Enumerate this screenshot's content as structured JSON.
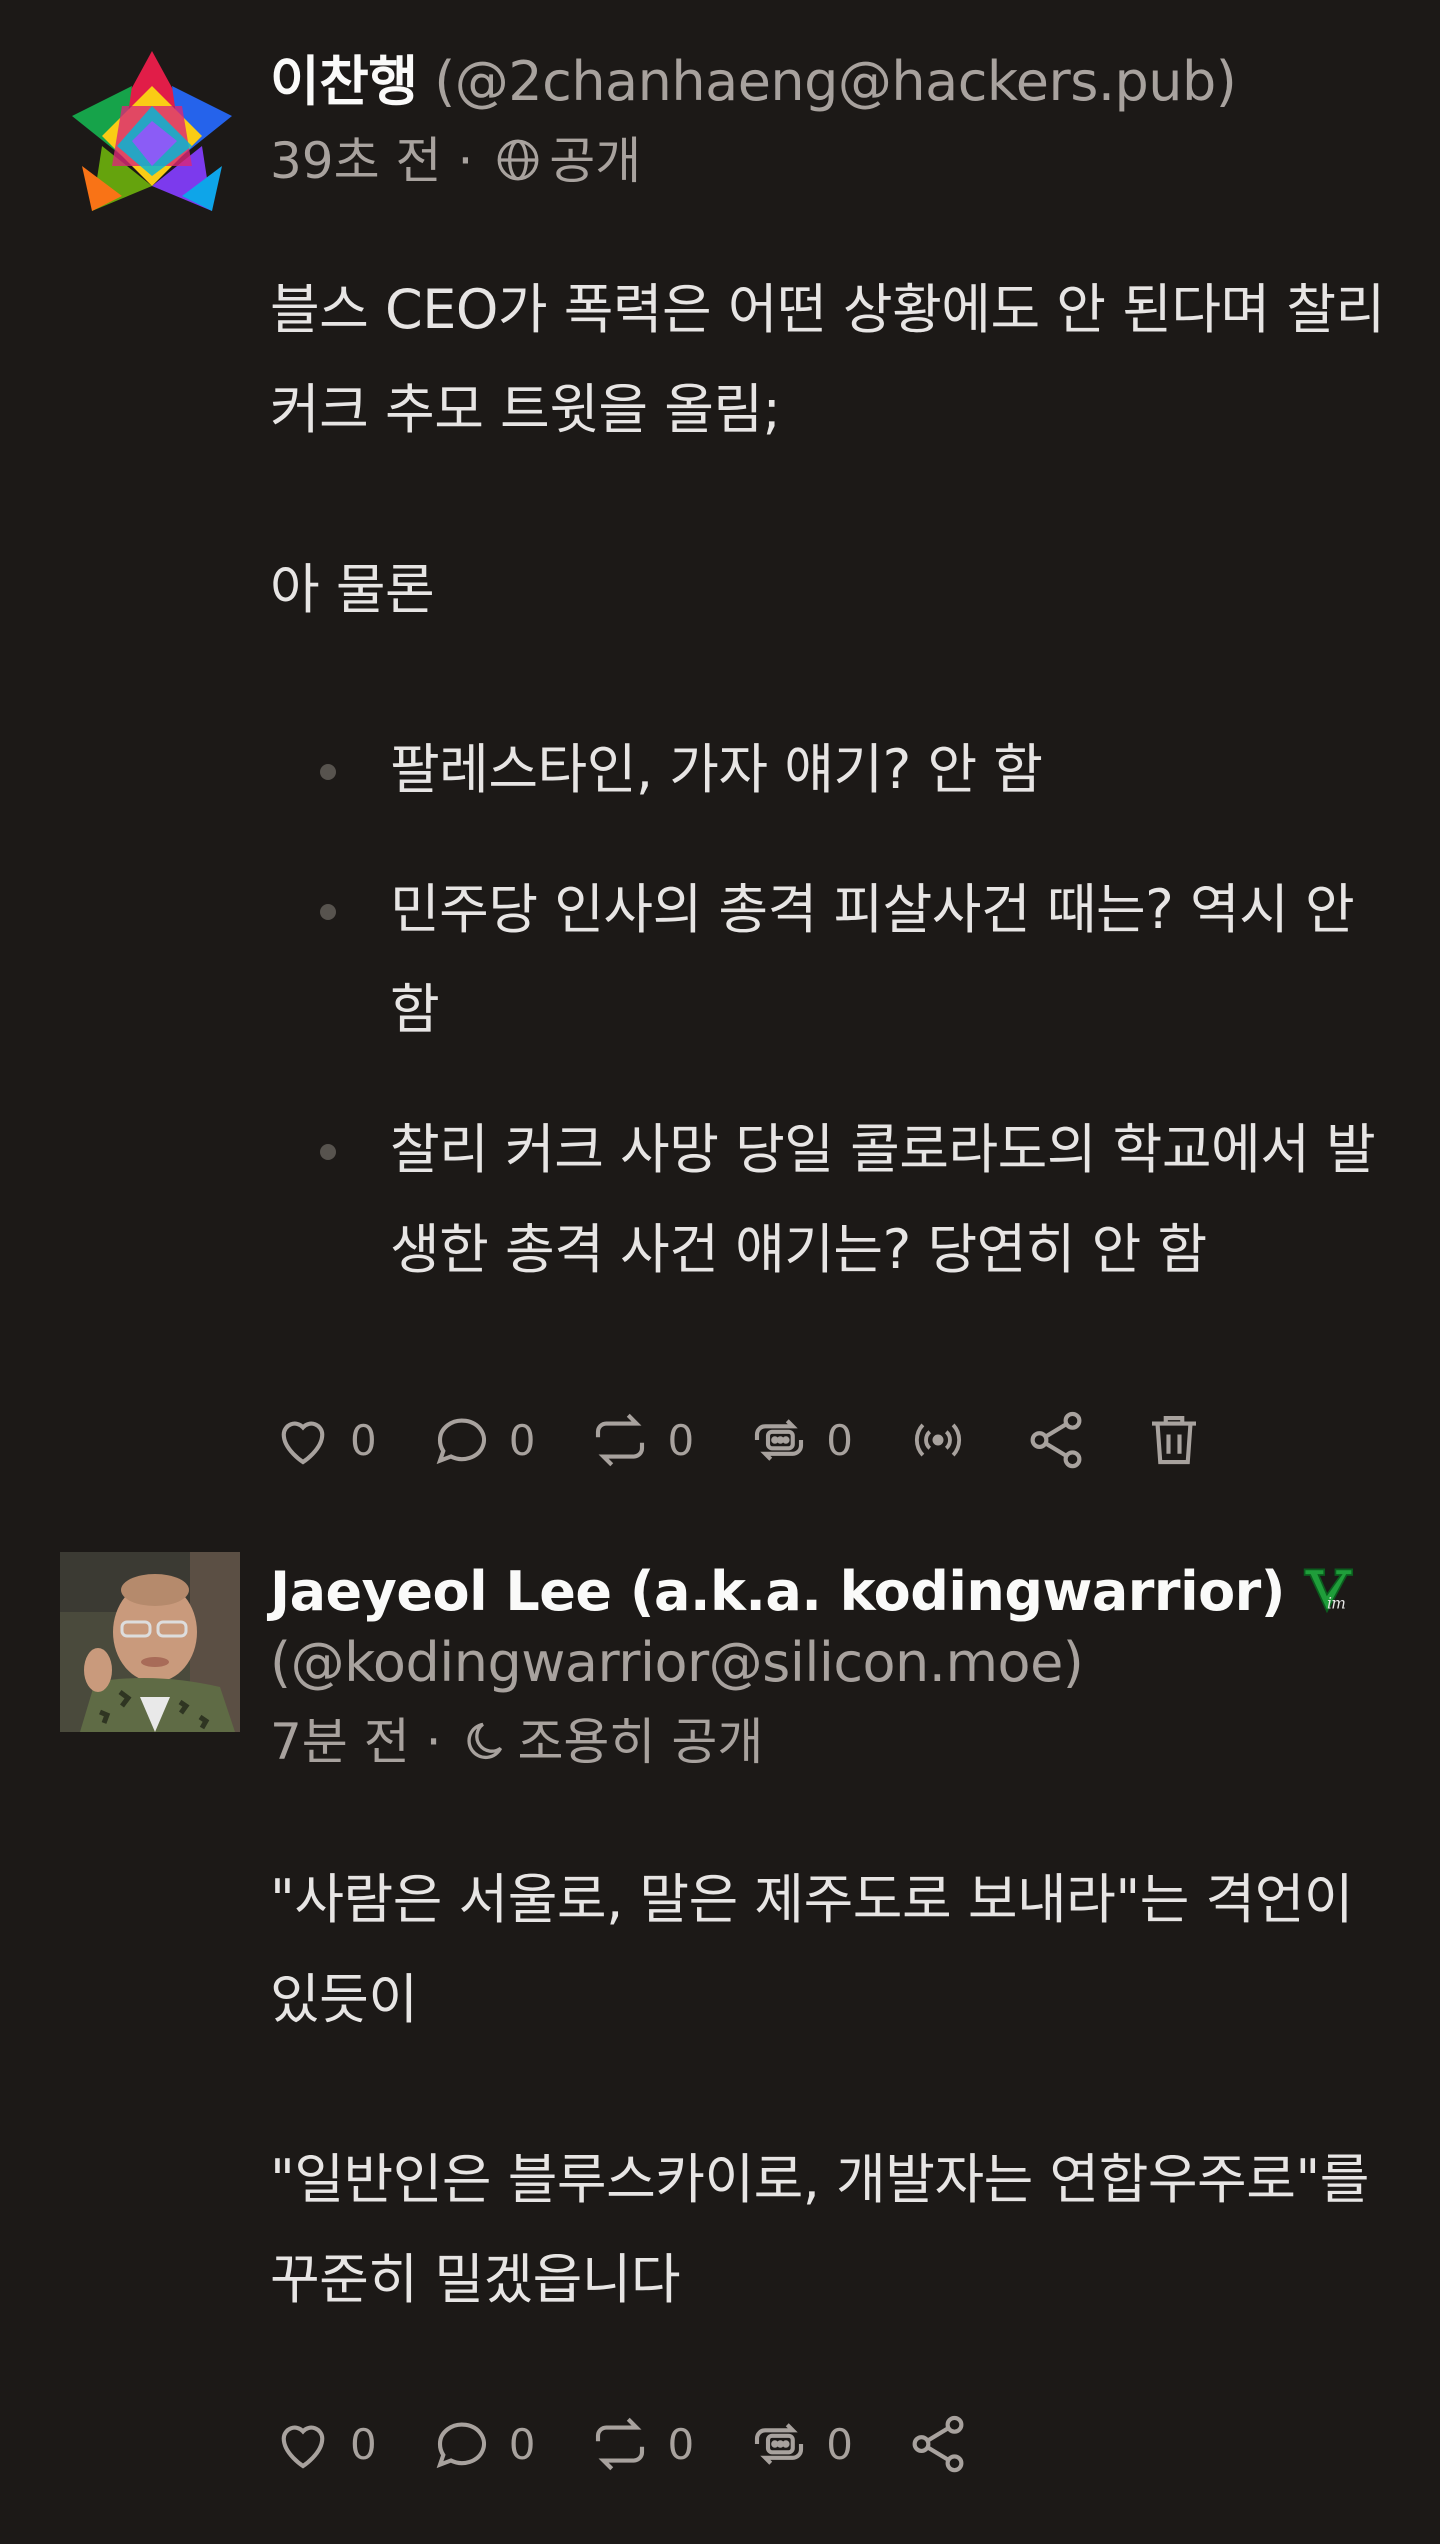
{
  "posts": [
    {
      "author": {
        "display_name": "이찬행",
        "handle": "(@2chanhaeng@hackers.pub)"
      },
      "time": "39초 전",
      "separator": "·",
      "visibility": "공개",
      "visibility_icon": "globe-icon",
      "paragraphs": [
        "블스 CEO가 폭력은 어떤 상황에도 안 된다며 찰리 커크 추모 트윗을 올림;",
        "아 물론"
      ],
      "list": [
        "팔레스타인, 가자 얘기? 안 함",
        "민주당 인사의 총격 피살사건 때는? 역시 안 함",
        "찰리 커크 사망 당일 콜로라도의 학교에서 발생한 총격 사건 얘기는? 당연히 안 함"
      ],
      "actions": {
        "like_count": "0",
        "reply_count": "0",
        "share_count": "0",
        "quote_count": "0"
      }
    },
    {
      "author": {
        "display_name": "Jaeyeol Lee (a.k.a. kodingwarrior)",
        "handle": "(@kodingwarrior@silicon.moe)"
      },
      "badge_icon": "vim-logo-icon",
      "time": "7분 전",
      "separator": "·",
      "visibility": "조용히 공개",
      "visibility_icon": "moon-icon",
      "paragraphs": [
        "\"사람은 서울로, 말은 제주도로 보내라\"는 격언이 있듯이",
        "\"일반인은 블루스카이로, 개발자는 연합우주로\"를 꾸준히 밀겠읍니다"
      ],
      "actions": {
        "like_count": "0",
        "reply_count": "0",
        "share_count": "0",
        "quote_count": "0"
      }
    }
  ],
  "colors": {
    "background": "#1c1917",
    "text": "#e7e5e4",
    "muted": "#a8a29e",
    "bullet": "#57534e"
  }
}
